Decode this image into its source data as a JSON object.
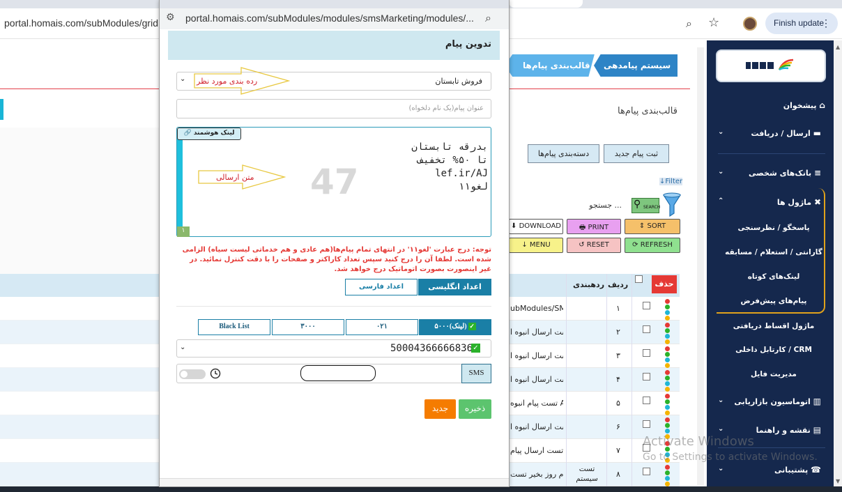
{
  "browser": {
    "background_url": "portal.homais.com/subModules/grid",
    "finish_update_label": "Finish update",
    "popup_url": "portal.homais.com/subModules/modules/smsMarketing/modules/..."
  },
  "sidebar": {
    "items": [
      {
        "label": "پیشخوان",
        "icon": "home-icon"
      },
      {
        "label": "ارسال / دریافت",
        "icon": "comment-icon"
      },
      {
        "label": "بانک‌های شخصی",
        "icon": "database-icon"
      },
      {
        "label": "ماژول ها",
        "icon": "tools-icon"
      },
      {
        "label": "اتوماسیون بازاریابی",
        "icon": "bar-chart-icon"
      },
      {
        "label": "نقشه و راهنما",
        "icon": "map-icon"
      },
      {
        "label": "پشتیبانی",
        "icon": "support-icon"
      }
    ],
    "subitems": [
      "پاسخگو / نظرسنجی",
      "گارانتی / استعلام / مسابقه",
      "لینک‌های کوتاه",
      "پیام‌های پیش‌فرض",
      "ماژول اقساط دریافتی",
      "کارتابل داخلی / CRM",
      "مدیریت فایل"
    ]
  },
  "breadcrumb": {
    "first": "سیستم پیامدهی",
    "second": "قالب‌بندی پیام‌ها"
  },
  "page": {
    "title": "قالب‌بندی پیام‌ها",
    "btn_new_message": "ثبت پیام جدید",
    "btn_categories": "دسته‌بندی پیام‌ها",
    "filter_label": "↓Filter",
    "search_placeholder": "جستجو ...",
    "search_btn": "SEARCH"
  },
  "toolbar": {
    "download": "DOWNLOAD",
    "print": "PRINT",
    "sort": "SORT",
    "menu": "MENU",
    "reset": "RESET",
    "refresh": "REFRESH"
  },
  "table": {
    "headers": {
      "delete": "حذف",
      "row": "ردیف",
      "category": "ردهبندی"
    },
    "rows": [
      {
        "num": "۱",
        "text": "ubModules/SMS",
        "cat": ""
      },
      {
        "num": "۲",
        "text": "تست ارسال انبوه ا",
        "cat": ""
      },
      {
        "num": "۳",
        "text": "تست ارسال انبوه ا",
        "cat": ""
      },
      {
        "num": "۴",
        "text": "تست ارسال انبوه ا",
        "cat": ""
      },
      {
        "num": "۵",
        "text": "تست پیام انبوه AI",
        "cat": ""
      },
      {
        "num": "۶",
        "text": "تست ارسال انبوه ا",
        "cat": ""
      },
      {
        "num": "۷",
        "text": "تست ارسال پیام",
        "cat": ""
      },
      {
        "num": "۸",
        "text": "سلام روز بخیر تست",
        "cat": "تست سیستم"
      }
    ]
  },
  "watermark": {
    "line1": "Activate Windows",
    "line2": "Go to Settings to activate Windows."
  },
  "modal": {
    "title": "تدوین پیام",
    "category_value": "فروش تابستان",
    "annotation_category": "رده بندی مورد نظر",
    "title_placeholder": "عنوان پیام(یک نام دلخواه)",
    "smart_link": "لینک هوشمند",
    "message_lines": [
      "بدرقه تابستان",
      "تا ۵۰% تخفیف",
      "lef.ir/AJ",
      "لغو۱۱"
    ],
    "char_count": "47",
    "sms_count": "۱",
    "annotation_message": "متن ارسالی",
    "note": "توجه: درج عبارت 'لغو۱۱' در انتهای تمام پیام‌ها(هم عادی و هم خدماتی لیست سیاه) الزامی شده است. لطفا آن را درج کنید سپس تعداد کاراکتر و صفحات را با دقت کنترل نمائید. در غیر اینصورت بصورت اتوماتیک درج خواهد شد.",
    "btn_english_digits": "اعداد انگلیسی",
    "btn_persian_digits": "اعداد فارسی",
    "line_tabs": {
      "tab_5000": "۵۰۰۰(لینک)",
      "tab_021": "۰۲۱",
      "tab_3000": "۳۰۰۰",
      "tab_blacklist": "Black List"
    },
    "sender_number": "50004366666836",
    "sms_label": "SMS",
    "btn_save": "ذخیره",
    "btn_new": "جدید"
  }
}
